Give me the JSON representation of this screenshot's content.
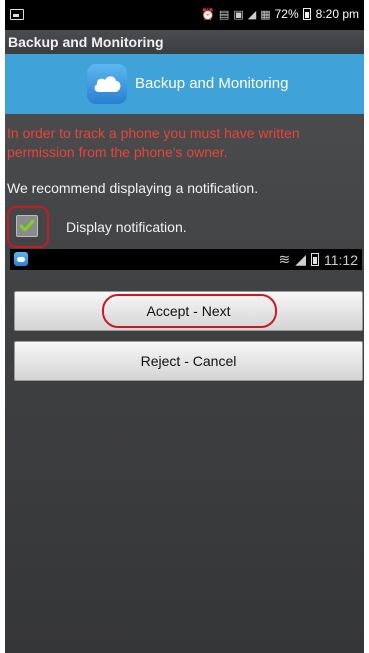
{
  "status_bar": {
    "battery_percent": "72%",
    "time": "8:20 pm"
  },
  "window": {
    "title": "Backup and Monitoring"
  },
  "banner": {
    "app_name": "Backup and Monitoring",
    "icon": "cloud-icon"
  },
  "content": {
    "warning": "In order to track a phone you must have written permission from the phone's owner.",
    "recommendation": "We recommend displaying a notification.",
    "checkbox_label": "Display notification.",
    "checkbox_checked": true
  },
  "inner_status_bar": {
    "time": "11:12"
  },
  "buttons": {
    "accept": "Accept - Next",
    "reject": "Reject - Cancel"
  },
  "colors": {
    "banner": "#3fa3d9",
    "warning_text": "#e8443a",
    "highlight_ring": "#c21d24"
  }
}
